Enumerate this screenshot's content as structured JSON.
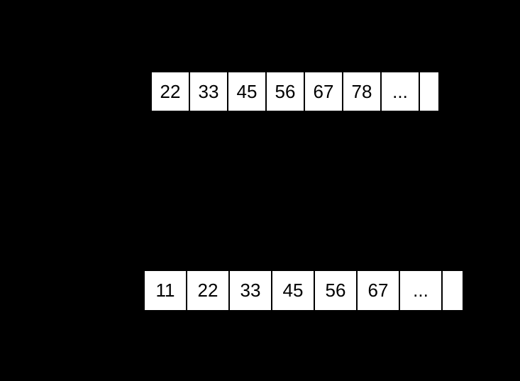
{
  "array1": {
    "cells": [
      "22",
      "33",
      "45",
      "56",
      "67",
      "78",
      "..."
    ]
  },
  "array2": {
    "cells": [
      "11",
      "22",
      "33",
      "45",
      "56",
      "67",
      "..."
    ]
  }
}
